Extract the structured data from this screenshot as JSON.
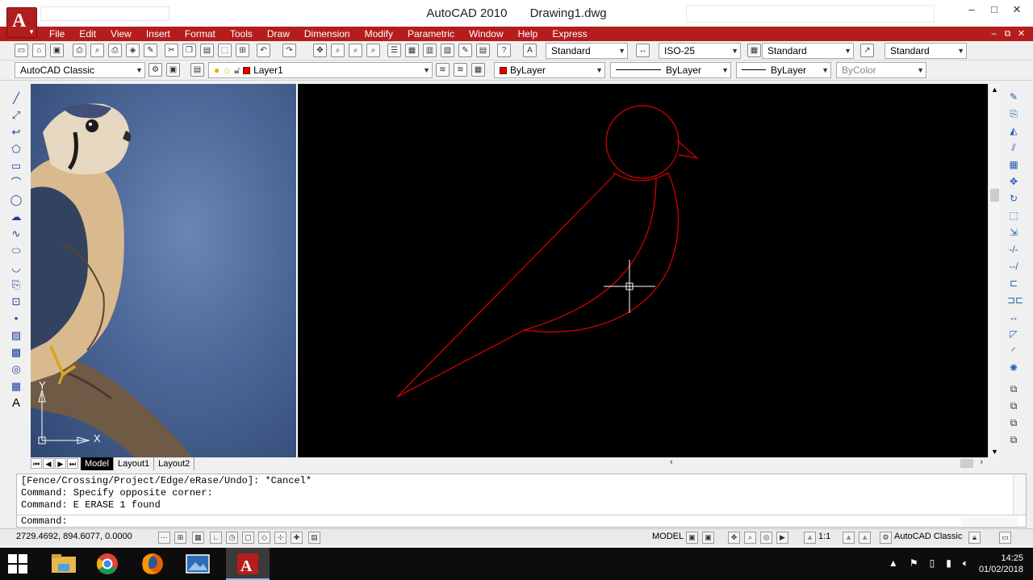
{
  "window": {
    "app_name": "AutoCAD 2010",
    "document": "Drawing1.dwg",
    "controls": [
      "–",
      "□",
      "✕"
    ]
  },
  "menu": {
    "items": [
      "File",
      "Edit",
      "View",
      "Insert",
      "Format",
      "Tools",
      "Draw",
      "Dimension",
      "Modify",
      "Parametric",
      "Window",
      "Help",
      "Express"
    ],
    "doc_controls": [
      "–",
      "⧉",
      "✕"
    ]
  },
  "toolbar": {
    "text_style": "Standard",
    "dim_style": "ISO-25",
    "table_style": "Standard",
    "multileader_style": "Standard",
    "workspace": "AutoCAD Classic",
    "layer": "Layer1",
    "color": "ByLayer",
    "linetype": "ByLayer",
    "lineweight": "ByLayer",
    "plot_style": "ByColor"
  },
  "ucs": {
    "x_label": "X",
    "y_label": "Y"
  },
  "drawing": {
    "line_color": "#e00000",
    "crosshair_color": "#ffffff",
    "background": "#000000"
  },
  "layout_tabs": [
    "Model",
    "Layout1",
    "Layout2"
  ],
  "command": {
    "history": [
      "[Fence/Crossing/Project/Edge/eRase/Undo]: *Cancel*",
      "Command: Specify opposite corner:",
      "Command: E ERASE 1 found"
    ],
    "prompt": "Command:"
  },
  "status": {
    "coordinates": "2729.4692, 894.6077, 0.0000",
    "model": "MODEL",
    "scale": "1:1",
    "workspace": "AutoCAD Classic"
  },
  "taskbar": {
    "time": "14:25",
    "date": "01/02/2018"
  }
}
